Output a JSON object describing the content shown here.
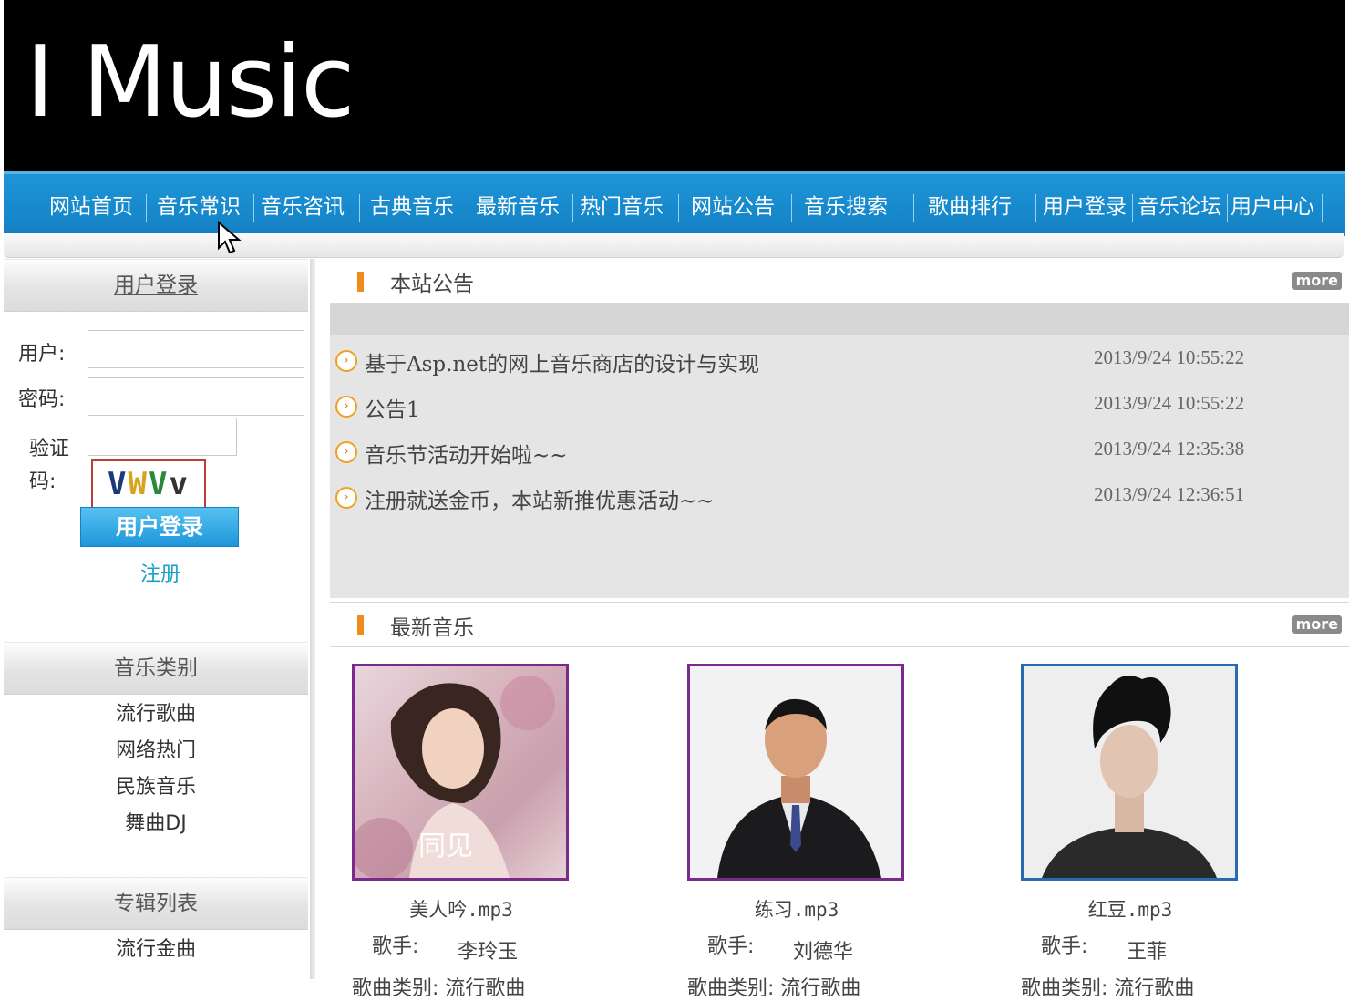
{
  "header": {
    "site_title": "I Music"
  },
  "nav": {
    "items": [
      "网站首页",
      "音乐常识",
      "音乐咨讯",
      "古典音乐",
      "最新音乐",
      "热门音乐",
      "网站公告",
      "音乐搜索",
      "歌曲排行",
      "用户登录",
      "音乐论坛",
      "用户中心"
    ]
  },
  "login": {
    "title": "用户登录",
    "user_label": "用户:",
    "password_label": "密码:",
    "captcha_label_1": "验证",
    "captcha_label_2": "码:",
    "captcha_text": [
      "V",
      "W",
      "V",
      "v"
    ],
    "login_button": "用户登录",
    "register_link": "注册"
  },
  "categories": {
    "title": "音乐类别",
    "items": [
      "流行歌曲",
      "网络热门",
      "民族音乐",
      "舞曲DJ"
    ]
  },
  "albums": {
    "title": "专辑列表",
    "items": [
      "流行金曲"
    ]
  },
  "notices": {
    "title": "本站公告",
    "more": "more",
    "items": [
      {
        "title": "基于Asp.net的网上音乐商店的设计与实现",
        "date": "2013/9/24 10:55:22"
      },
      {
        "title": "公告1",
        "date": "2013/9/24 10:55:22"
      },
      {
        "title": "音乐节活动开始啦~~",
        "date": "2013/9/24 12:35:38"
      },
      {
        "title": "注册就送金币，本站新推优惠活动~~",
        "date": "2013/9/24 12:36:51"
      }
    ]
  },
  "latest_music": {
    "title": "最新音乐",
    "more": "more",
    "singer_label": "歌手:",
    "category_label": "歌曲类别:",
    "items": [
      {
        "file": "美人吟.mp3",
        "singer": "李玲玉",
        "category": "流行歌曲",
        "cover_text": "同见"
      },
      {
        "file": "练习.mp3",
        "singer": "刘德华",
        "category": "流行歌曲"
      },
      {
        "file": "红豆.mp3",
        "singer": "王菲",
        "category": "流行歌曲"
      }
    ]
  },
  "colors": {
    "nav_blue": "#1689cc",
    "accent_orange": "#f08a1a",
    "link_teal": "#18a0c8",
    "cover_border_1": "#7a2a8a",
    "cover_border_3": "#2a6ab0"
  }
}
